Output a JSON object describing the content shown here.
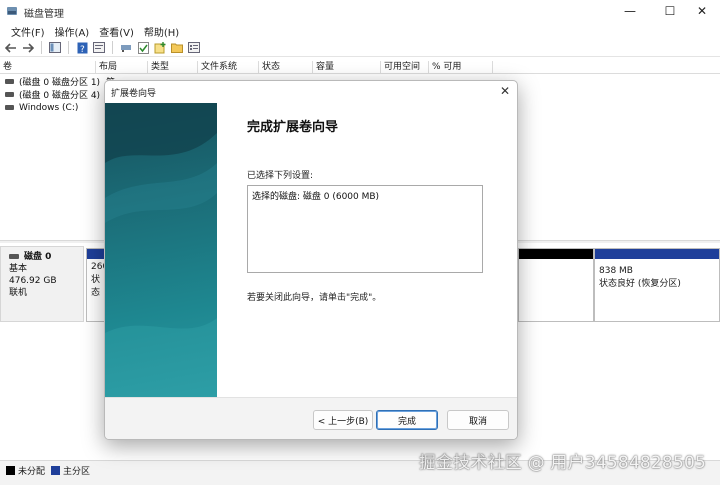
{
  "window": {
    "title": "磁盘管理",
    "controls": {
      "minimize": "—",
      "maximize": "☐",
      "close": "✕"
    }
  },
  "menu": [
    "文件(F)",
    "操作(A)",
    "查看(V)",
    "帮助(H)"
  ],
  "toolbar_icons": [
    "back-arrow-icon",
    "forward-arrow-icon",
    "console-tree-icon",
    "help-icon",
    "properties-icon",
    "connect-icon",
    "check-icon",
    "new-volume-icon",
    "open-folder-icon",
    "settings-list-icon"
  ],
  "volume_list": {
    "columns": [
      "卷",
      "布局",
      "类型",
      "文件系统",
      "状态",
      "容量",
      "可用空间",
      "% 可用"
    ],
    "rows": [
      [
        "(磁盘 0 磁盘分区 1)",
        "简",
        "",
        "",
        "",
        "",
        "",
        ""
      ],
      [
        "(磁盘 0 磁盘分区 4)",
        "简",
        "",
        "",
        "",
        "",
        "",
        ""
      ],
      [
        "Windows (C:)",
        "",
        "",
        "",
        "",
        "",
        "",
        ""
      ]
    ]
  },
  "disk_map": {
    "disk": {
      "name": "磁盘 0",
      "type": "基本",
      "size": "476.92 GB",
      "status": "联机"
    },
    "partitions": [
      {
        "line1": "260",
        "line2": "状态"
      },
      {
        "line1": "838 MB",
        "line2": "状态良好 (恢复分区)"
      }
    ]
  },
  "legend": [
    {
      "label": "未分配",
      "color": "#000000"
    },
    {
      "label": "主分区",
      "color": "#1f3f9a"
    }
  ],
  "watermark": "掘金技术社区 @ 用户3458482850​5",
  "dialog": {
    "title": "扩展卷向导",
    "heading": "完成扩展卷向导",
    "selected_label": "已选择下列设置:",
    "settings_text": "选择的磁盘: 磁盘 0 (6000 MB)",
    "note": "若要关闭此向导，请单击\"完成\"。",
    "buttons": {
      "back": "< 上一步(B)",
      "finish": "完成",
      "cancel": "取消"
    },
    "close": "✕"
  },
  "colors": {
    "primary_partition": "#1f3f9a",
    "unallocated": "#000000",
    "wizard_teal": "#1b6d78"
  }
}
